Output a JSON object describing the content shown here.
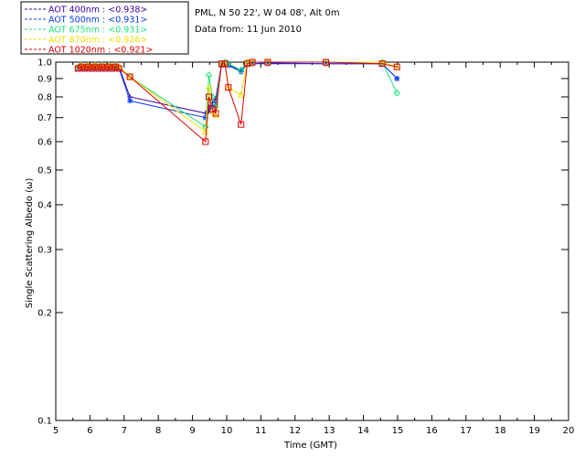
{
  "chart_data": {
    "type": "scatter",
    "station": "PML, N 50 22', W 04 08', Alt 0m",
    "date_text": "Data from: 11 Jun 2010",
    "xlabel": "Time (GMT)",
    "ylabel": "Single Scattering Albedo (ω)",
    "xlim": [
      5,
      20
    ],
    "ylim": [
      0.1,
      1.0
    ],
    "yscale": "log",
    "grid": false,
    "legend_position": "top-left-outside",
    "x_ticks": [
      5,
      6,
      7,
      8,
      9,
      10,
      11,
      12,
      13,
      14,
      15,
      16,
      17,
      18,
      19,
      20
    ],
    "y_ticks": [
      "1.0",
      "0.9",
      "0.8",
      "0.7",
      "0.6",
      "0.5",
      "0.4",
      "0.3",
      "0.2",
      "0.1"
    ],
    "series": [
      {
        "name": "AOT 400nm",
        "legend_value": "<0.938>",
        "color": "#3b00a8",
        "marker": "plus",
        "x": [
          5.65,
          5.75,
          5.85,
          5.95,
          6.05,
          6.15,
          6.25,
          6.35,
          6.45,
          6.55,
          6.65,
          6.75,
          6.85,
          7.17,
          9.38,
          9.48,
          9.58,
          9.68,
          9.85,
          9.95,
          10.05,
          10.42,
          10.6,
          10.75,
          11.2,
          12.9,
          14.55,
          14.98
        ],
        "y": [
          0.97,
          0.98,
          0.97,
          0.98,
          0.97,
          0.98,
          0.97,
          0.98,
          0.97,
          0.98,
          0.97,
          0.98,
          0.97,
          0.8,
          0.72,
          0.75,
          0.77,
          0.79,
          0.99,
          0.99,
          0.98,
          0.95,
          0.99,
          0.99,
          0.995,
          0.99,
          0.99,
          0.9
        ]
      },
      {
        "name": "AOT 500nm",
        "legend_value": "<0.931>",
        "color": "#0a3cff",
        "marker": "star",
        "x": [
          5.65,
          5.75,
          5.85,
          5.95,
          6.05,
          6.15,
          6.25,
          6.35,
          6.45,
          6.55,
          6.65,
          6.75,
          6.85,
          7.17,
          9.38,
          9.48,
          9.58,
          9.68,
          9.85,
          9.95,
          10.05,
          10.42,
          10.6,
          10.75,
          11.2,
          12.9,
          14.55,
          14.98
        ],
        "y": [
          0.96,
          0.97,
          0.96,
          0.97,
          0.96,
          0.97,
          0.96,
          0.97,
          0.96,
          0.97,
          0.96,
          0.97,
          0.96,
          0.78,
          0.7,
          0.73,
          0.75,
          0.77,
          0.98,
          0.99,
          0.98,
          0.94,
          0.99,
          0.99,
          0.99,
          0.99,
          0.99,
          0.9
        ]
      },
      {
        "name": "AOT 675nm",
        "legend_value": "<0.931>",
        "color": "#1ee07a",
        "marker": "diamond",
        "x": [
          5.65,
          5.75,
          5.85,
          5.95,
          6.05,
          6.15,
          6.25,
          6.35,
          6.45,
          6.55,
          6.65,
          6.75,
          6.85,
          7.17,
          9.38,
          9.48,
          9.58,
          9.68,
          9.85,
          9.95,
          10.05,
          10.42,
          10.6,
          10.75,
          11.2,
          12.9,
          14.55,
          14.98
        ],
        "y": [
          0.97,
          0.98,
          0.97,
          0.98,
          0.97,
          0.98,
          0.97,
          0.98,
          0.97,
          0.98,
          0.97,
          0.98,
          0.97,
          0.91,
          0.66,
          0.92,
          0.8,
          0.75,
          0.99,
          1.0,
          0.99,
          0.95,
          1.0,
          1.0,
          1.0,
          1.0,
          1.0,
          0.82
        ]
      },
      {
        "name": "AOT 870nm",
        "legend_value": "<0.926>",
        "color": "#f0e000",
        "marker": "triangle",
        "x": [
          5.65,
          5.75,
          5.85,
          5.95,
          6.05,
          6.15,
          6.25,
          6.35,
          6.45,
          6.55,
          6.65,
          6.75,
          6.85,
          7.17,
          9.38,
          9.48,
          9.58,
          9.68,
          9.85,
          9.95,
          10.05,
          10.42,
          10.6,
          10.75,
          11.2,
          12.9,
          14.55,
          14.98
        ],
        "y": [
          0.97,
          0.98,
          0.97,
          0.98,
          0.97,
          0.98,
          0.97,
          0.98,
          0.97,
          0.98,
          0.97,
          0.98,
          0.97,
          0.91,
          0.64,
          0.85,
          0.73,
          0.71,
          0.99,
          0.99,
          0.85,
          0.81,
          1.0,
          1.0,
          1.0,
          1.0,
          1.0,
          0.97
        ]
      },
      {
        "name": "AOT 1020nm",
        "legend_value": "<0.921>",
        "color": "#e00000",
        "marker": "square",
        "x": [
          5.65,
          5.75,
          5.85,
          5.95,
          6.05,
          6.15,
          6.25,
          6.35,
          6.45,
          6.55,
          6.65,
          6.75,
          6.85,
          7.17,
          9.38,
          9.48,
          9.58,
          9.68,
          9.85,
          9.95,
          10.05,
          10.42,
          10.6,
          10.75,
          11.2,
          12.9,
          14.55,
          14.98
        ],
        "y": [
          0.96,
          0.97,
          0.96,
          0.97,
          0.96,
          0.97,
          0.96,
          0.97,
          0.96,
          0.97,
          0.96,
          0.97,
          0.96,
          0.91,
          0.6,
          0.8,
          0.74,
          0.72,
          0.99,
          0.99,
          0.85,
          0.67,
          0.99,
          1.0,
          1.0,
          1.0,
          0.99,
          0.97
        ]
      }
    ]
  }
}
